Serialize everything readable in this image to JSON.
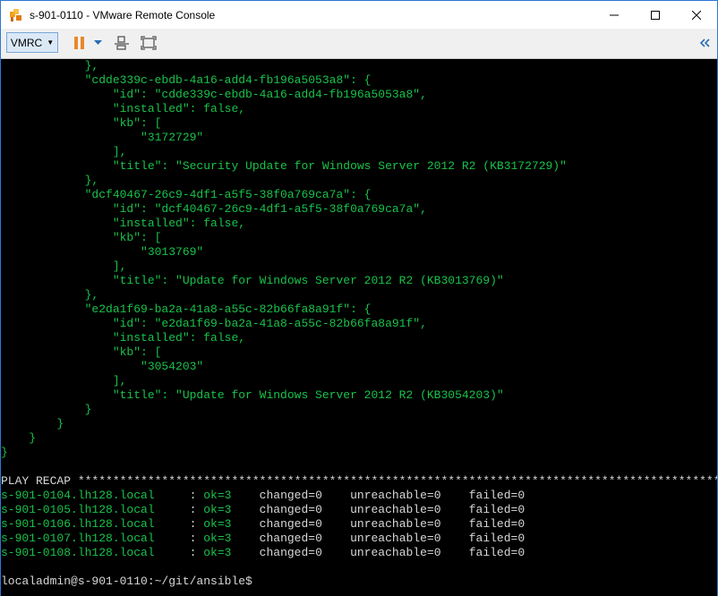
{
  "window": {
    "title": "s-901-0110 - VMware Remote Console"
  },
  "toolbar": {
    "vmrc_label": "VMRC"
  },
  "json_lines": [
    "            },",
    "            \"cdde339c-ebdb-4a16-add4-fb196a5053a8\": {",
    "                \"id\": \"cdde339c-ebdb-4a16-add4-fb196a5053a8\",",
    "                \"installed\": false,",
    "                \"kb\": [",
    "                    \"3172729\"",
    "                ],",
    "                \"title\": \"Security Update for Windows Server 2012 R2 (KB3172729)\"",
    "            },",
    "            \"dcf40467-26c9-4df1-a5f5-38f0a769ca7a\": {",
    "                \"id\": \"dcf40467-26c9-4df1-a5f5-38f0a769ca7a\",",
    "                \"installed\": false,",
    "                \"kb\": [",
    "                    \"3013769\"",
    "                ],",
    "                \"title\": \"Update for Windows Server 2012 R2 (KB3013769)\"",
    "            },",
    "            \"e2da1f69-ba2a-41a8-a55c-82b66fa8a91f\": {",
    "                \"id\": \"e2da1f69-ba2a-41a8-a55c-82b66fa8a91f\",",
    "                \"installed\": false,",
    "                \"kb\": [",
    "                    \"3054203\"",
    "                ],",
    "                \"title\": \"Update for Windows Server 2012 R2 (KB3054203)\"",
    "            }",
    "        }",
    "    }",
    "}"
  ],
  "recap_header": "PLAY RECAP *********************************************************************************************",
  "recap_rows": [
    {
      "host": "s-901-0104.lh128.local",
      "ok": "ok=3",
      "changed": "changed=0",
      "unreachable": "unreachable=0",
      "failed": "failed=0"
    },
    {
      "host": "s-901-0105.lh128.local",
      "ok": "ok=3",
      "changed": "changed=0",
      "unreachable": "unreachable=0",
      "failed": "failed=0"
    },
    {
      "host": "s-901-0106.lh128.local",
      "ok": "ok=3",
      "changed": "changed=0",
      "unreachable": "unreachable=0",
      "failed": "failed=0"
    },
    {
      "host": "s-901-0107.lh128.local",
      "ok": "ok=3",
      "changed": "changed=0",
      "unreachable": "unreachable=0",
      "failed": "failed=0"
    },
    {
      "host": "s-901-0108.lh128.local",
      "ok": "ok=3",
      "changed": "changed=0",
      "unreachable": "unreachable=0",
      "failed": "failed=0"
    }
  ],
  "prompt": "localadmin@s-901-0110:~/git/ansible$",
  "colors": {
    "terminal_green": "#19c24a",
    "terminal_text": "#d8d8d8",
    "background": "#000000"
  }
}
